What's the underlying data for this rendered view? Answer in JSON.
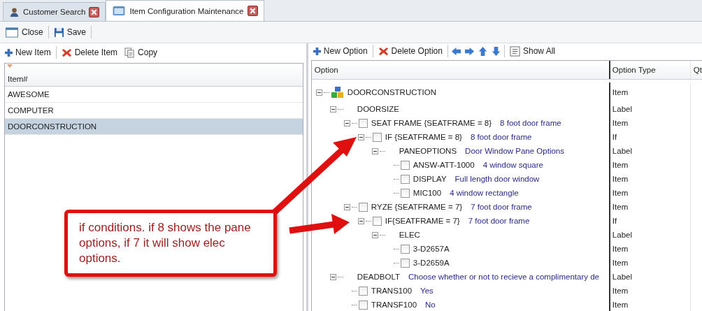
{
  "tabs": [
    {
      "label": "Customer Search",
      "selected": false
    },
    {
      "label": "Item Configuration Maintenance",
      "selected": true
    }
  ],
  "main_toolbar": [
    "Close",
    "Save"
  ],
  "items_panel": {
    "toolbar": [
      "New Item",
      "Delete Item",
      "Copy"
    ],
    "column": "Item#",
    "rows": [
      {
        "label": "AWESOME",
        "selected": false
      },
      {
        "label": "COMPUTER",
        "selected": false
      },
      {
        "label": "DOORCONSTRUCTION",
        "selected": true
      }
    ]
  },
  "options_panel": {
    "toolbar": [
      "New Option",
      "Delete Option",
      "Show All"
    ],
    "columns": [
      "Option",
      "Option Type",
      "Qt"
    ],
    "tree": [
      {
        "kind": "root",
        "name": "DOORCONSTRUCTION",
        "type": "Item",
        "expanded": true,
        "children": [
          {
            "kind": "label",
            "name": "DOORSIZE",
            "type": "Label",
            "expanded": true,
            "children": [
              {
                "kind": "option",
                "name": "SEAT FRAME {SEATFRAME = 8}",
                "description": "8 foot door frame",
                "type": "Item",
                "checked": false,
                "expanded": true,
                "children": [
                  {
                    "kind": "option",
                    "name": "IF {SEATFRAME = 8}",
                    "description": "8 foot door frame",
                    "type": "If",
                    "checked": false,
                    "expanded": true,
                    "children": [
                      {
                        "kind": "label",
                        "name": "PANEOPTIONS",
                        "description": "Door Window Pane Options",
                        "type": "Label",
                        "expanded": true,
                        "children": [
                          {
                            "kind": "option",
                            "name": "ANSW-ATT-1000",
                            "description": "4 window square",
                            "type": "Item",
                            "checked": false
                          },
                          {
                            "kind": "option",
                            "name": "DISPLAY",
                            "description": "Full length door window",
                            "type": "Item",
                            "checked": false
                          },
                          {
                            "kind": "option",
                            "name": "MIC100",
                            "description": "4 window rectangle",
                            "type": "Item",
                            "checked": false
                          }
                        ]
                      }
                    ]
                  }
                ]
              },
              {
                "kind": "option",
                "name": "RYZE {SEATFRAME = 7}",
                "description": "7 foot door frame",
                "type": "Item",
                "checked": false,
                "expanded": true,
                "children": [
                  {
                    "kind": "option",
                    "name": "IF{SEATFRAME = 7}",
                    "description": "7 foot door frame",
                    "type": "If",
                    "checked": false,
                    "expanded": true,
                    "children": [
                      {
                        "kind": "label",
                        "name": "ELEC",
                        "type": "Label",
                        "expanded": true,
                        "children": [
                          {
                            "kind": "option",
                            "name": "3-D2657A",
                            "type": "Item",
                            "checked": false
                          },
                          {
                            "kind": "option",
                            "name": "3-D2659A",
                            "type": "Item",
                            "checked": false
                          }
                        ]
                      }
                    ]
                  }
                ]
              }
            ]
          },
          {
            "kind": "label",
            "name": "DEADBOLT",
            "description": "Choose whether or not to recieve a complimentary de",
            "type": "Label",
            "expanded": true,
            "children": [
              {
                "kind": "option",
                "name": "TRANS100",
                "description": "Yes",
                "type": "Item",
                "checked": false
              },
              {
                "kind": "option",
                "name": "TRANSF100",
                "description": "No",
                "type": "Item",
                "checked": false
              }
            ]
          }
        ]
      }
    ]
  },
  "callout": {
    "text": "if conditions. if 8 shows the pane options, if 7 it will show elec options."
  }
}
